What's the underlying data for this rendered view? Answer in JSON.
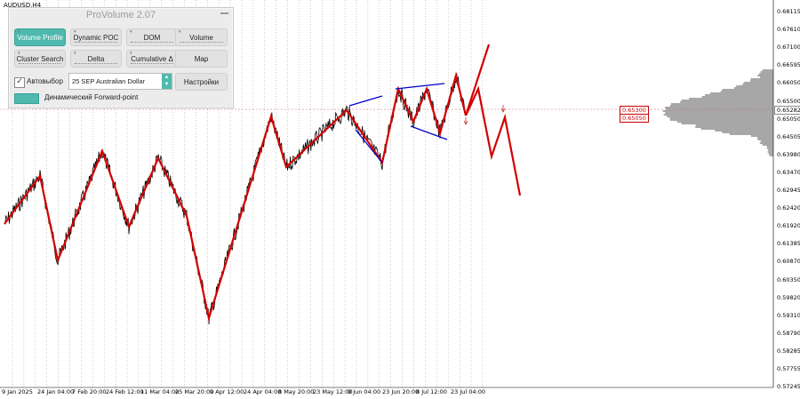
{
  "symbol": "AUDUSD,H4",
  "panel": {
    "title": "ProVolume 2.07",
    "buttons": [
      {
        "label": "Volume Profile",
        "active": true
      },
      {
        "label": "Dynamic POC",
        "active": false
      },
      {
        "label": "DOM",
        "active": false
      },
      {
        "label": "Volume",
        "active": false
      },
      {
        "label": "Cluster Search",
        "active": false
      },
      {
        "label": "Delta",
        "active": false
      },
      {
        "label": "Cumulative Δ",
        "active": false
      },
      {
        "label": "Map",
        "active": false
      }
    ],
    "auto_select_label": "Автовыбор",
    "auto_select_checked": true,
    "instrument": "25 SEP Australian Dollar",
    "settings_label": "Настройки",
    "forward_point_label": "Динамический Forward-point",
    "accent_color": "#4fb9b0"
  },
  "price_axis": [
    "0.68115",
    "0.67610",
    "0.67100",
    "0.66595",
    "0.66050",
    "0.65500",
    "0.65050",
    "0.64505",
    "0.63980",
    "0.63470",
    "0.62945",
    "0.62420",
    "0.61920",
    "0.61385",
    "0.60870",
    "0.60350",
    "0.59820",
    "0.59310",
    "0.58790",
    "0.58285",
    "0.57755",
    "0.57245"
  ],
  "price_labels": {
    "current": "0.65282",
    "level_1": "0.65300",
    "level_2": "0.65050"
  },
  "time_axis": [
    "9 Jan 2025",
    "24 Jan 04:00",
    "7 Feb 20:00",
    "24 Feb 12:00",
    "11 Mar 04:00",
    "25 Mar 20:00",
    "9 Apr 12:00",
    "24 Apr 04:00",
    "8 May 20:00",
    "23 May 12:00",
    "9 Jun 04:00",
    "23 Jun 20:00",
    "8 Jul 12:00",
    "23 Jul 04:00"
  ],
  "colors": {
    "zigzag": "#d40000",
    "candles": "#000000",
    "wedge": "#0000cc",
    "profile": "#8a8a8a",
    "grid": "#999999"
  }
}
